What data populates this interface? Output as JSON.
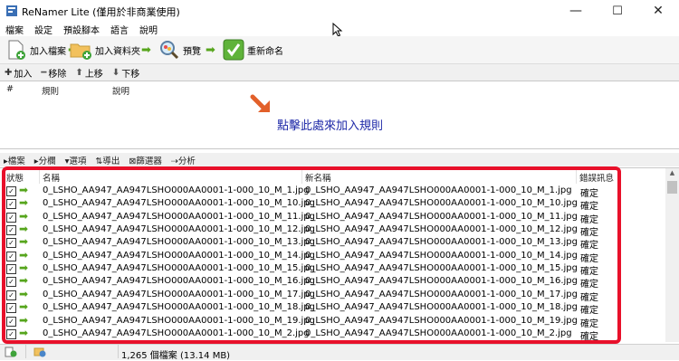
{
  "window": {
    "title": "ReNamer Lite (僅用於非商業使用)",
    "minimize_glyph": "—",
    "maximize_glyph": "☐",
    "close_glyph": "✕"
  },
  "menu": [
    "檔案",
    "設定",
    "預設腳本",
    "語言",
    "說明"
  ],
  "toolbar": {
    "add_files": "加入檔案",
    "add_folders": "加入資料夾",
    "preview": "預覽",
    "rename": "重新命名"
  },
  "rules_bar": {
    "add": "加入",
    "remove": "移除",
    "up": "上移",
    "down": "下移"
  },
  "rules_panel": {
    "col_number": "#",
    "col_rule": "規則",
    "col_description": "說明",
    "hint": "點擊此處來加入規則"
  },
  "files_bar": {
    "files": "檔案",
    "columns": "分欄",
    "options": "選項",
    "export": "導出",
    "filters": "篩選器",
    "analyze": "分析"
  },
  "file_list": {
    "col_status": "狀態",
    "col_name": "名稱",
    "col_new_name": "新名稱",
    "col_error": "錯誤訊息",
    "rows": [
      {
        "name": "0_LSHO_AA947_AA947LSHO000AA0001-1-000_10_M_1.jpg",
        "new_name": "0_LSHO_AA947_AA947LSHO000AA0001-1-000_10_M_1.jpg",
        "error": "確定"
      },
      {
        "name": "0_LSHO_AA947_AA947LSHO000AA0001-1-000_10_M_10.jpg",
        "new_name": "0_LSHO_AA947_AA947LSHO000AA0001-1-000_10_M_10.jpg",
        "error": "確定"
      },
      {
        "name": "0_LSHO_AA947_AA947LSHO000AA0001-1-000_10_M_11.jpg",
        "new_name": "0_LSHO_AA947_AA947LSHO000AA0001-1-000_10_M_11.jpg",
        "error": "確定"
      },
      {
        "name": "0_LSHO_AA947_AA947LSHO000AA0001-1-000_10_M_12.jpg",
        "new_name": "0_LSHO_AA947_AA947LSHO000AA0001-1-000_10_M_12.jpg",
        "error": "確定"
      },
      {
        "name": "0_LSHO_AA947_AA947LSHO000AA0001-1-000_10_M_13.jpg",
        "new_name": "0_LSHO_AA947_AA947LSHO000AA0001-1-000_10_M_13.jpg",
        "error": "確定"
      },
      {
        "name": "0_LSHO_AA947_AA947LSHO000AA0001-1-000_10_M_14.jpg",
        "new_name": "0_LSHO_AA947_AA947LSHO000AA0001-1-000_10_M_14.jpg",
        "error": "確定"
      },
      {
        "name": "0_LSHO_AA947_AA947LSHO000AA0001-1-000_10_M_15.jpg",
        "new_name": "0_LSHO_AA947_AA947LSHO000AA0001-1-000_10_M_15.jpg",
        "error": "確定"
      },
      {
        "name": "0_LSHO_AA947_AA947LSHO000AA0001-1-000_10_M_16.jpg",
        "new_name": "0_LSHO_AA947_AA947LSHO000AA0001-1-000_10_M_16.jpg",
        "error": "確定"
      },
      {
        "name": "0_LSHO_AA947_AA947LSHO000AA0001-1-000_10_M_17.jpg",
        "new_name": "0_LSHO_AA947_AA947LSHO000AA0001-1-000_10_M_17.jpg",
        "error": "確定"
      },
      {
        "name": "0_LSHO_AA947_AA947LSHO000AA0001-1-000_10_M_18.jpg",
        "new_name": "0_LSHO_AA947_AA947LSHO000AA0001-1-000_10_M_18.jpg",
        "error": "確定"
      },
      {
        "name": "0_LSHO_AA947_AA947LSHO000AA0001-1-000_10_M_19.jpg",
        "new_name": "0_LSHO_AA947_AA947LSHO000AA0001-1-000_10_M_19.jpg",
        "error": "確定"
      },
      {
        "name": "0_LSHO_AA947_AA947LSHO000AA0001-1-000_10_M_2.jpg",
        "new_name": "0_LSHO_AA947_AA947LSHO000AA0001-1-000_10_M_2.jpg",
        "error": "確定"
      }
    ]
  },
  "status": {
    "summary": "1,265 個檔案 (13.14 MB)"
  },
  "colors": {
    "highlight": "#e8102a",
    "accent_green": "#56a51c",
    "hint_blue": "#1f2aa8"
  }
}
